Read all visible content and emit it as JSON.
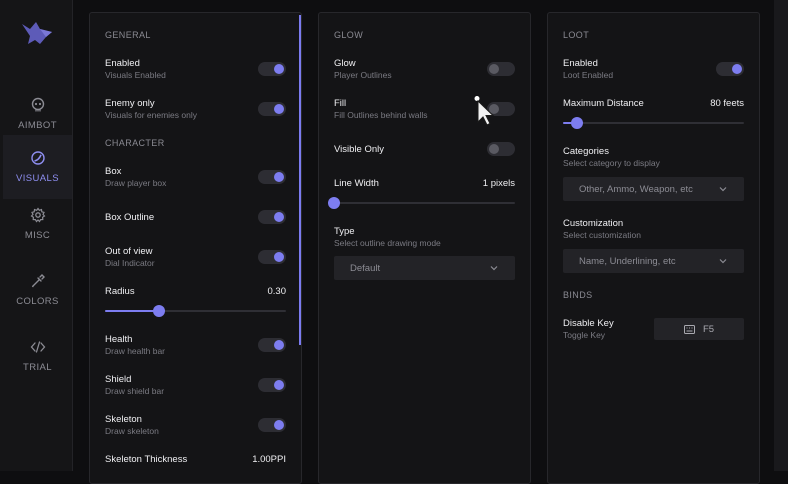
{
  "sidebar": {
    "items": [
      {
        "label": "AIMBOT",
        "icon": "skull-icon"
      },
      {
        "label": "VISUALS",
        "icon": "visuals-icon"
      },
      {
        "label": "MISC",
        "icon": "gear-icon"
      },
      {
        "label": "COLORS",
        "icon": "eyedropper-icon"
      },
      {
        "label": "TRIAL",
        "icon": "code-icon"
      }
    ],
    "active": "VISUALS"
  },
  "general": {
    "title": "GENERAL",
    "enabled": {
      "label": "Enabled",
      "sub": "Visuals Enabled",
      "on": true
    },
    "enemy_only": {
      "label": "Enemy only",
      "sub": "Visuals for enemies only",
      "on": true
    }
  },
  "character": {
    "title": "CHARACTER",
    "box": {
      "label": "Box",
      "sub": "Draw player box",
      "on": true
    },
    "box_outline": {
      "label": "Box Outline",
      "on": true
    },
    "out_of_view": {
      "label": "Out of view",
      "sub": "Dial Indicator",
      "on": true
    },
    "radius": {
      "label": "Radius",
      "value": "0.30",
      "fraction": 0.3
    },
    "health": {
      "label": "Health",
      "sub": "Draw health bar",
      "on": true
    },
    "shield": {
      "label": "Shield",
      "sub": "Draw shield bar",
      "on": true
    },
    "skeleton": {
      "label": "Skeleton",
      "sub": "Draw skeleton",
      "on": true
    },
    "skeleton_thickness": {
      "label": "Skeleton Thickness",
      "value": "1.00PPI"
    }
  },
  "glow": {
    "title": "GLOW",
    "glow": {
      "label": "Glow",
      "sub": "Player Outlines",
      "on": false
    },
    "fill": {
      "label": "Fill",
      "sub": "Fill Outlines behind walls",
      "on": false
    },
    "visible_only": {
      "label": "Visible Only",
      "on": false
    },
    "line_width": {
      "label": "Line Width",
      "value": "1 pixels",
      "fraction": 0.0
    },
    "type": {
      "label": "Type",
      "sub": "Select outline drawing mode",
      "selected": "Default"
    }
  },
  "loot": {
    "title": "LOOT",
    "enabled": {
      "label": "Enabled",
      "sub": "Loot Enabled",
      "on": true
    },
    "max_distance": {
      "label": "Maximum Distance",
      "value": "80 feets",
      "fraction": 0.08
    },
    "categories": {
      "label": "Categories",
      "sub": "Select category to display",
      "selected": "Other, Ammo, Weapon, etc"
    },
    "customization": {
      "label": "Customization",
      "sub": "Select customization",
      "selected": "Name, Underlining, etc"
    }
  },
  "binds": {
    "title": "BINDS",
    "disable_key": {
      "label": "Disable Key",
      "sub": "Toggle Key",
      "key": "F5"
    }
  },
  "colors": {
    "accent": "#7d7df0",
    "background": "#0e0e10",
    "panel": "#141416"
  }
}
